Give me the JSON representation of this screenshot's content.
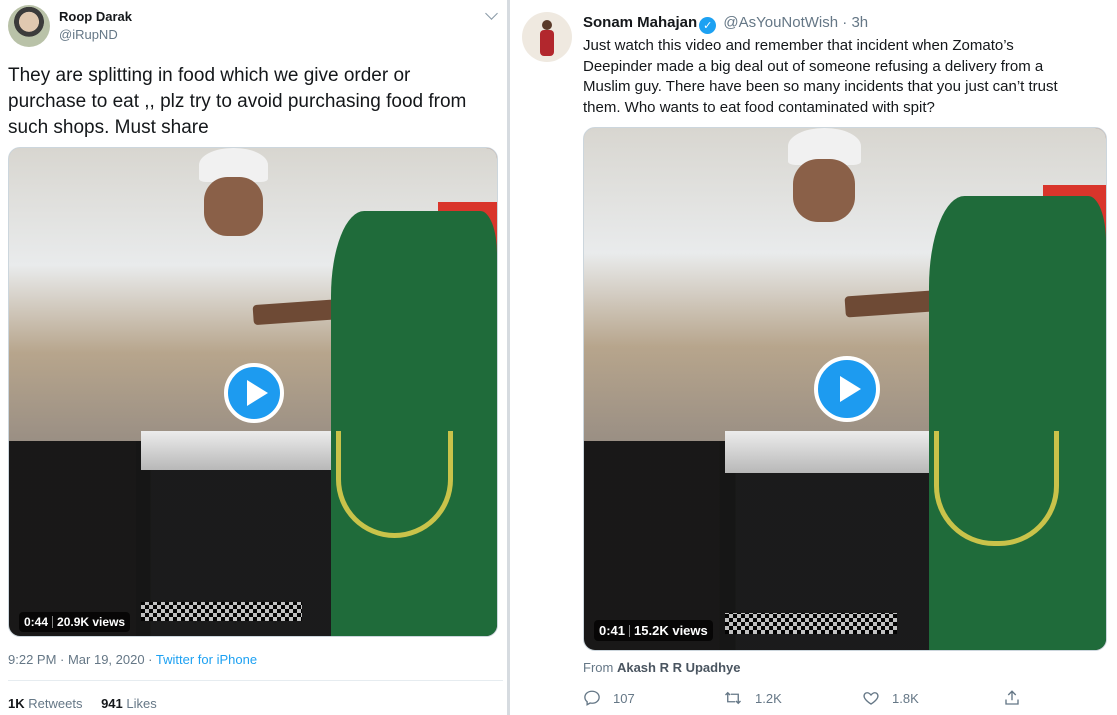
{
  "left_tweet": {
    "author_name": "Roop Darak",
    "author_handle": "@iRupND",
    "text_lines": [
      "They are splitting in food which we give order or",
      "purchase to eat  ,, plz try to avoid purchasing  food from",
      "such shops. Must share"
    ],
    "video_duration": "0:44",
    "video_views": "20.9K views",
    "timestamp": "9:22 PM · Mar 19, 2020 · ",
    "source": "Twitter for iPhone",
    "retweets_count": "1K",
    "retweets_label": "Retweets",
    "likes_count": "941",
    "likes_label": "Likes"
  },
  "right_tweet": {
    "author_name": "Sonam Mahajan",
    "author_handle": "@AsYouNotWish",
    "time_ago": "· 3h",
    "text_lines": [
      "Just watch this video and remember that incident when Zomato’s",
      "Deepinder made a big deal out of someone refusing a delivery from a",
      "Muslim guy. There have been so many incidents that you just can’t trust",
      "them. Who wants to eat food contaminated with spit?"
    ],
    "video_duration": "0:41",
    "video_views": "15.2K views",
    "from_label": "From ",
    "from_name": "Akash R R Upadhye",
    "replies": "107",
    "retweets": "1.2K",
    "likes": "1.8K"
  },
  "colors": {
    "accent": "#1da1f2",
    "muted_text": "#657786",
    "play_button": "#1d9bf0"
  },
  "icons": [
    "chevron-down-icon",
    "verified-icon",
    "play-icon",
    "reply-icon",
    "retweet-icon",
    "like-icon",
    "share-icon"
  ]
}
